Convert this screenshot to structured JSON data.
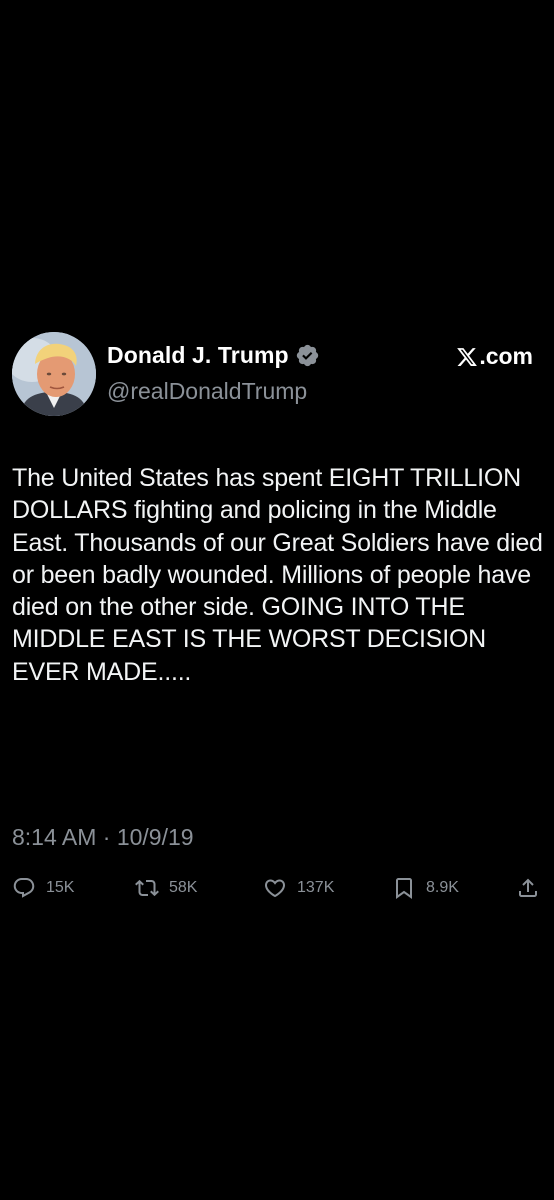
{
  "tweet": {
    "author": {
      "display_name": "Donald J. Trump",
      "handle": "@realDonaldTrump",
      "verified": true,
      "avatar_icon": "profile-photo"
    },
    "source": {
      "label": ".com",
      "logo_icon": "x-logo"
    },
    "text": "The United States has spent EIGHT TRILLION DOLLARS fighting and policing in the Middle East. Thousands of our Great Soldiers have died or been badly wounded. Millions of people have died on the other side. GOING INTO THE MIDDLE EAST IS THE WORST DECISION EVER MADE.....",
    "timestamp": "8:14 AM · 10/9/19",
    "actions": {
      "reply": {
        "icon": "reply-icon",
        "count": "15K"
      },
      "repost": {
        "icon": "repost-icon",
        "count": "58K"
      },
      "like": {
        "icon": "heart-icon",
        "count": "137K"
      },
      "bookmark": {
        "icon": "bookmark-icon",
        "count": "8.9K"
      },
      "share": {
        "icon": "share-icon"
      }
    }
  },
  "colors": {
    "background": "#000000",
    "primary_text": "#ffffff",
    "secondary_text": "#8b9198",
    "verified_badge": "#8b9198"
  }
}
